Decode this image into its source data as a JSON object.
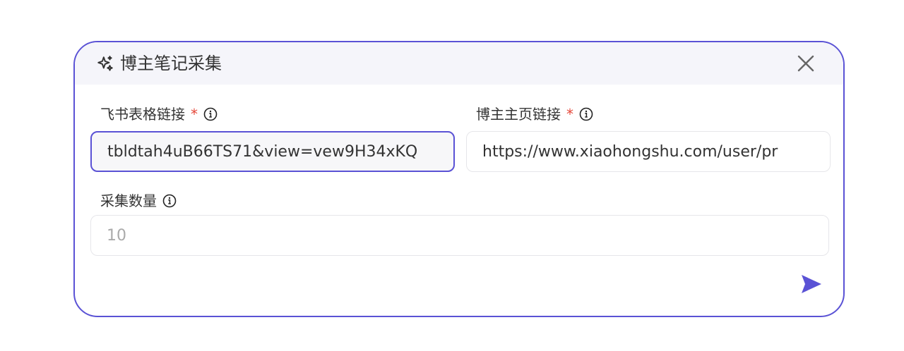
{
  "dialog": {
    "title": "博主笔记采集",
    "icons": {
      "header": "sparkles-icon",
      "close": "close-icon",
      "send": "send-icon",
      "info": "info-icon"
    }
  },
  "fields": {
    "feishu": {
      "label": "飞书表格链接",
      "required_mark": "*",
      "value": "tbldtah4uB66TS71&view=vew9H34xKQ"
    },
    "blogger": {
      "label": "博主主页链接",
      "required_mark": "*",
      "value": "https://www.xiaohongshu.com/user/pr"
    },
    "count": {
      "label": "采集数量",
      "placeholder": "10"
    }
  },
  "colors": {
    "accent": "#5a52d5",
    "required": "#e5483a",
    "header_bg": "#f5f5fa"
  }
}
